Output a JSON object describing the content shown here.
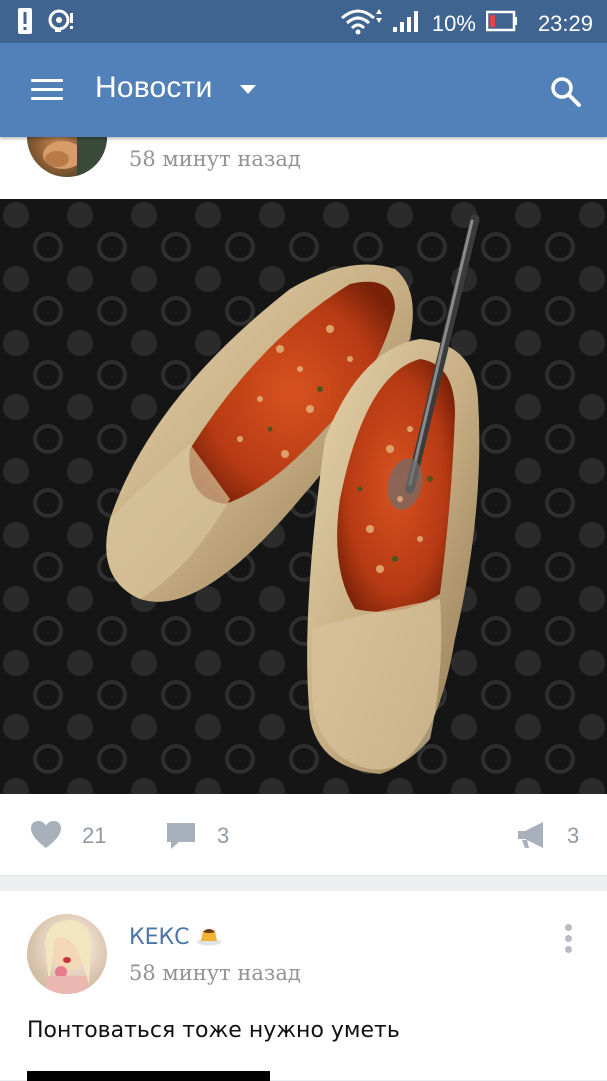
{
  "status_bar": {
    "battery_percent": "10%",
    "time": "23:29"
  },
  "app_bar": {
    "title": "Новости"
  },
  "post1": {
    "time_ago": "58 минут назад",
    "likes": "21",
    "comments": "3",
    "reposts": "3"
  },
  "post2": {
    "author": "КЕКС",
    "time_ago": "58 минут назад",
    "text": "Понтоваться тоже нужно уметь"
  },
  "colors": {
    "status_bar": "#3f6490",
    "app_bar": "#5181b8",
    "link": "#4a76a8",
    "muted": "#939393"
  },
  "icons": [
    "alert-icon",
    "notification-icon",
    "wifi-icon",
    "signal-icon",
    "battery-icon",
    "menu-icon",
    "dropdown-caret-icon",
    "search-icon",
    "heart-icon",
    "comment-icon",
    "megaphone-icon",
    "more-vertical-icon",
    "pudding-emoji-icon"
  ]
}
